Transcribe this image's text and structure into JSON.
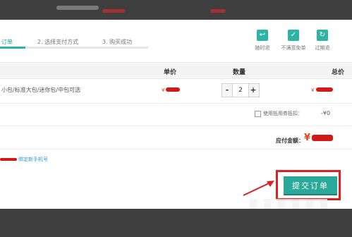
{
  "steps": [
    {
      "label": "订单",
      "active": true
    },
    {
      "label": "2. 选择支付方式",
      "active": false
    },
    {
      "label": "3. 购买成功",
      "active": false
    }
  ],
  "progress_fraction": 0.17,
  "actions": [
    {
      "label": "随时退",
      "icon": "return-icon",
      "glyph": "↩"
    },
    {
      "label": "不满意免单",
      "icon": "check-icon",
      "glyph": "✓"
    },
    {
      "label": "过期退",
      "icon": "refresh-icon",
      "glyph": "↻"
    }
  ],
  "table": {
    "headers": {
      "price": "单价",
      "quantity": "数量",
      "total": "总价"
    },
    "row": {
      "name": "小包/标准大包/迷你包/中包可选",
      "price_symbol": "¥",
      "quantity": "2",
      "minus": "-",
      "plus": "+",
      "total_symbol": "¥"
    }
  },
  "coupon": {
    "label": "使用抵用券抵扣：",
    "amount": "-¥0"
  },
  "payable": {
    "label": "应付金额：",
    "symbol": "¥"
  },
  "phone_link": "绑定新手机号",
  "submit_label": "提交订单",
  "colors": {
    "accent": "#2aa898",
    "highlight": "#e02020",
    "price": "#e04a1a"
  }
}
